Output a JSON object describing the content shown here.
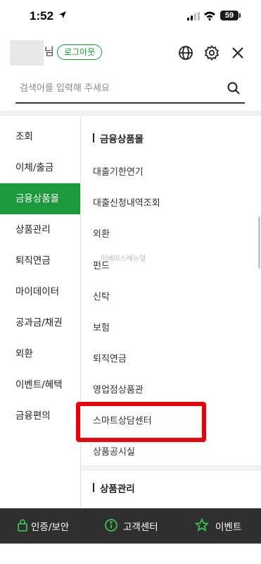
{
  "status_bar": {
    "time": "1:52",
    "battery": "59"
  },
  "header": {
    "name_suffix": "님",
    "logout_label": "로그아웃"
  },
  "search": {
    "placeholder": "검색어를 입력해 주세요",
    "value": ""
  },
  "left_menu": {
    "items": [
      {
        "label": "조회",
        "active": false
      },
      {
        "label": "이체/출금",
        "active": false
      },
      {
        "label": "금융상품몰",
        "active": true
      },
      {
        "label": "상품관리",
        "active": false
      },
      {
        "label": "퇴직연금",
        "active": false
      },
      {
        "label": "마이데이터",
        "active": false
      },
      {
        "label": "공과금/채권",
        "active": false
      },
      {
        "label": "외환",
        "active": false
      },
      {
        "label": "이벤트/혜택",
        "active": false
      },
      {
        "label": "금융편의",
        "active": false
      }
    ]
  },
  "right_panel": {
    "section1_title": "금융상품몰",
    "items": [
      "대출기한연기",
      "대출신청내역조회",
      "외환",
      "펀드",
      "신탁",
      "보험",
      "퇴직연금",
      "영업점상품관",
      "스마트상담센터",
      "상품공시실"
    ],
    "section2_title": "상품관리",
    "watermark": "이베이스매뉴얼"
  },
  "bottom_bar": {
    "items": [
      {
        "label": "인증/보안",
        "icon": "lock-icon"
      },
      {
        "label": "고객센터",
        "icon": "info-circle-icon"
      },
      {
        "label": "이벤트",
        "icon": "star-icon"
      }
    ]
  },
  "colors": {
    "accent": "#1a9a3a",
    "highlight": "#e8000b",
    "bottom_bar": "#2f2f2f"
  }
}
